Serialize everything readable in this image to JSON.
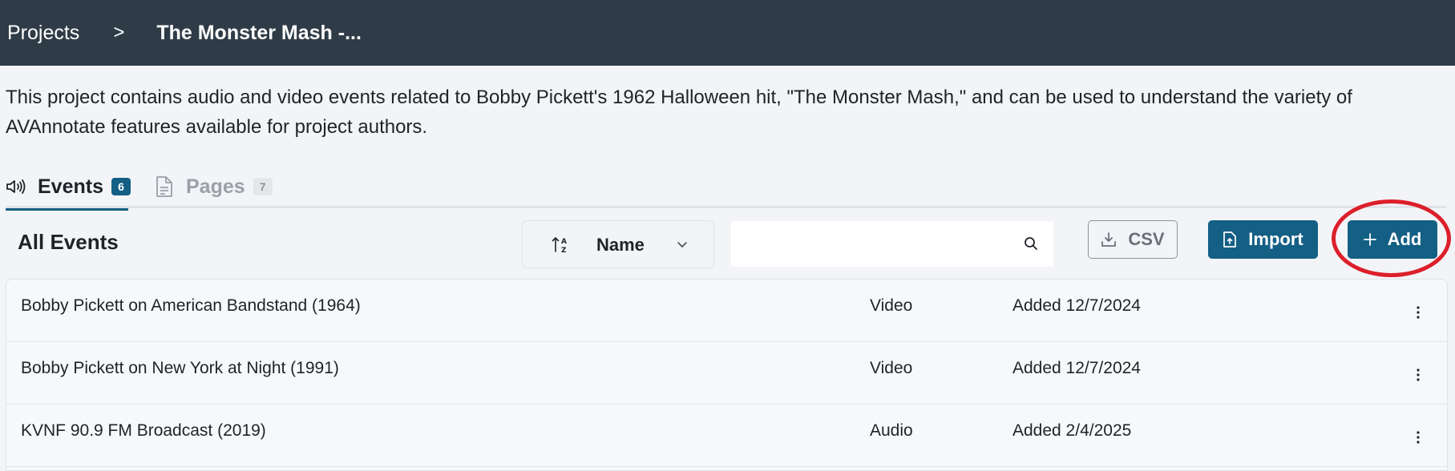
{
  "breadcrumb": {
    "root": "Projects",
    "separator": ">",
    "current": "The Monster Mash -..."
  },
  "project": {
    "description": "This project contains audio and video events related to Bobby Pickett's 1962 Halloween hit, \"The Monster Mash,\" and can be used to understand the variety of AVAnnotate features available for project authors."
  },
  "tabs": [
    {
      "label": "Events",
      "count": "6",
      "icon": "speaker-icon",
      "active": true
    },
    {
      "label": "Pages",
      "count": "7",
      "icon": "document-icon",
      "active": false
    }
  ],
  "toolbar": {
    "title": "All Events",
    "sort_label": "Name",
    "search_placeholder": "",
    "csv_label": "CSV",
    "import_label": "Import",
    "add_label": "Add"
  },
  "events": [
    {
      "name": "Bobby Pickett on American Bandstand (1964)",
      "type": "Video",
      "added": "Added 12/7/2024"
    },
    {
      "name": "Bobby Pickett on New York at Night (1991)",
      "type": "Video",
      "added": "Added 12/7/2024"
    },
    {
      "name": "KVNF 90.9 FM Broadcast (2019)",
      "type": "Audio",
      "added": "Added 2/4/2025"
    }
  ],
  "colors": {
    "header_bg": "#2f3c47",
    "accent": "#145f84",
    "highlight": "#dc1f2b",
    "page_bg": "#f3f4f7"
  }
}
